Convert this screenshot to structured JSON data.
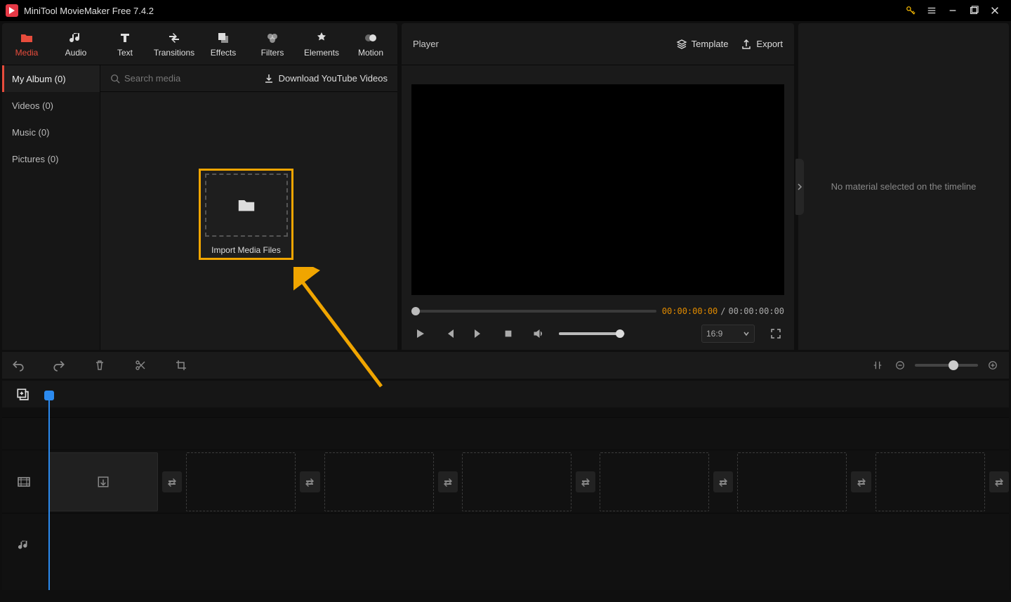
{
  "titlebar": {
    "title": "MiniTool MovieMaker Free 7.4.2"
  },
  "tabs": {
    "media": "Media",
    "audio": "Audio",
    "text": "Text",
    "transitions": "Transitions",
    "effects": "Effects",
    "filters": "Filters",
    "elements": "Elements",
    "motion": "Motion"
  },
  "categories": {
    "my_album": "My Album (0)",
    "videos": "Videos (0)",
    "music": "Music (0)",
    "pictures": "Pictures (0)"
  },
  "search": {
    "placeholder": "Search media"
  },
  "yt_download": "Download YouTube Videos",
  "import_label": "Import Media Files",
  "player": {
    "title": "Player",
    "template": "Template",
    "export": "Export",
    "time_current": "00:00:00:00",
    "time_sep": "/",
    "time_total": "00:00:00:00",
    "aspect": "16:9"
  },
  "right_panel": {
    "msg": "No material selected on the timeline"
  }
}
